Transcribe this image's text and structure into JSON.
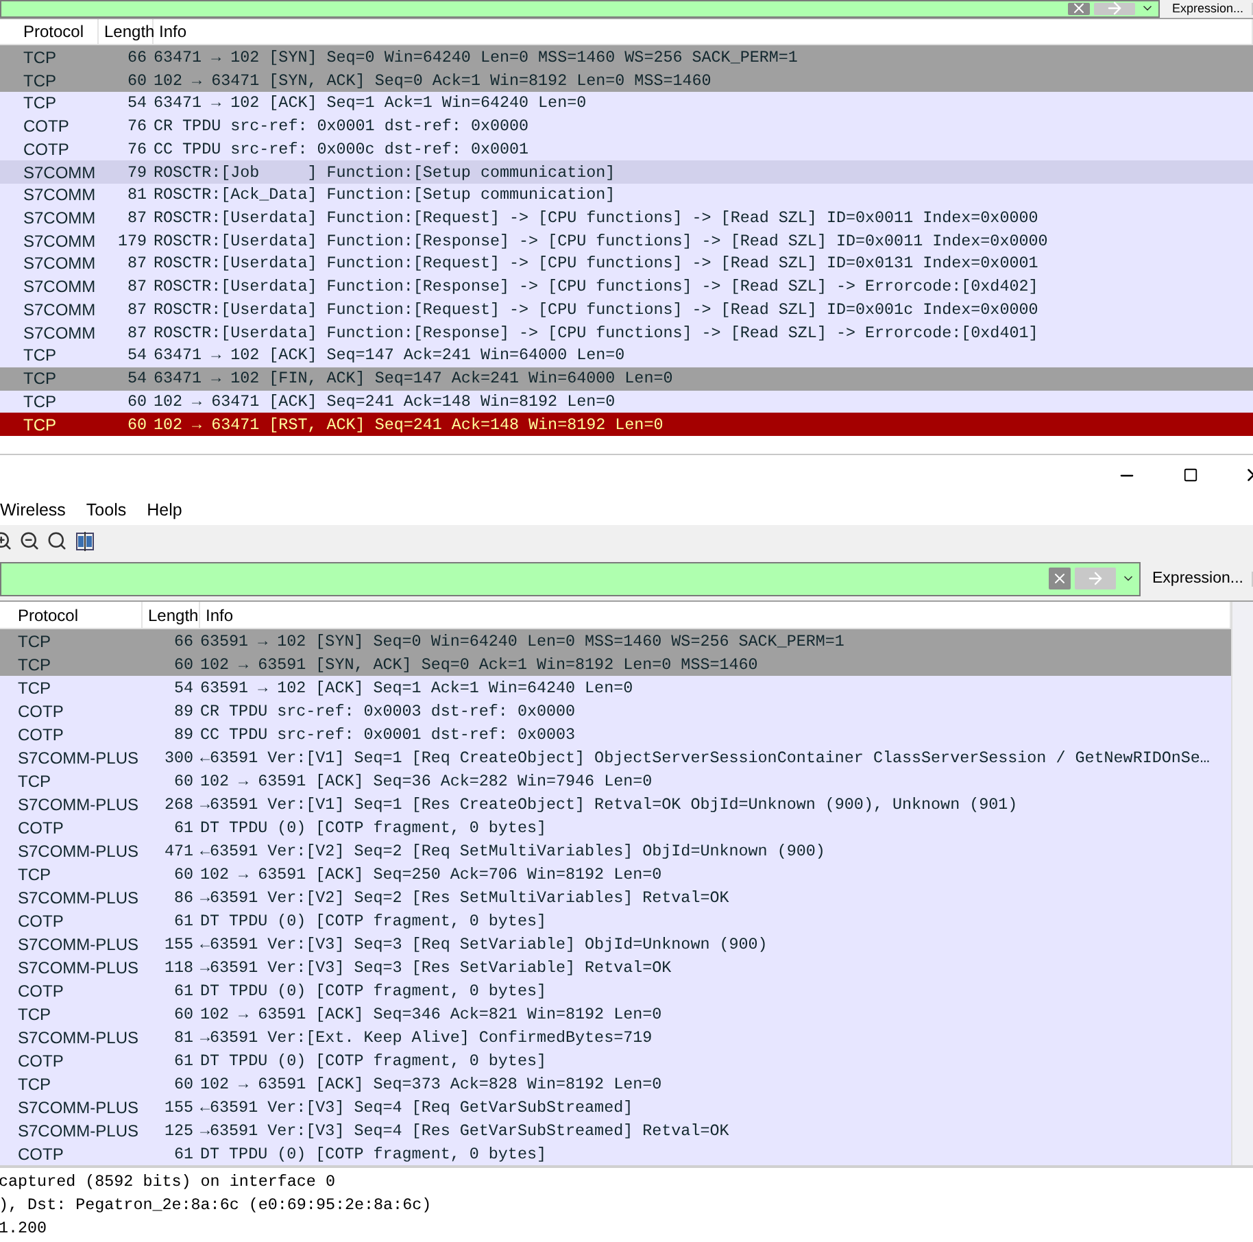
{
  "top_pane": {
    "filter": {
      "expression_button": "Expression..."
    },
    "columns": [
      "Protocol",
      "Length",
      "Info"
    ],
    "rows": [
      {
        "protocol": "TCP",
        "length": "66",
        "info": "63471 → 102 [SYN] Seq=0 Win=64240 Len=0 MSS=1460 WS=256 SACK_PERM=1",
        "kind": "handshake"
      },
      {
        "protocol": "TCP",
        "length": "60",
        "info": "102 → 63471 [SYN, ACK] Seq=0 Ack=1 Win=8192 Len=0 MSS=1460",
        "kind": "handshake"
      },
      {
        "protocol": "TCP",
        "length": "54",
        "info": "63471 → 102 [ACK] Seq=1 Ack=1 Win=64240 Len=0",
        "kind": "normal"
      },
      {
        "protocol": "COTP",
        "length": "76",
        "info": "CR TPDU src-ref: 0x0001 dst-ref: 0x0000",
        "kind": "normal"
      },
      {
        "protocol": "COTP",
        "length": "76",
        "info": "CC TPDU src-ref: 0x000c dst-ref: 0x0001",
        "kind": "normal"
      },
      {
        "protocol": "S7COMM",
        "length": "79",
        "info": "ROSCTR:[Job     ] Function:[Setup communication]",
        "kind": "marked"
      },
      {
        "protocol": "S7COMM",
        "length": "81",
        "info": "ROSCTR:[Ack_Data] Function:[Setup communication]",
        "kind": "normal"
      },
      {
        "protocol": "S7COMM",
        "length": "87",
        "info": "ROSCTR:[Userdata] Function:[Request] -> [CPU functions] -> [Read SZL] ID=0x0011 Index=0x0000",
        "kind": "normal"
      },
      {
        "protocol": "S7COMM",
        "length": "179",
        "info": "ROSCTR:[Userdata] Function:[Response] -> [CPU functions] -> [Read SZL] ID=0x0011 Index=0x0000",
        "kind": "normal"
      },
      {
        "protocol": "S7COMM",
        "length": "87",
        "info": "ROSCTR:[Userdata] Function:[Request] -> [CPU functions] -> [Read SZL] ID=0x0131 Index=0x0001",
        "kind": "normal"
      },
      {
        "protocol": "S7COMM",
        "length": "87",
        "info": "ROSCTR:[Userdata] Function:[Response] -> [CPU functions] -> [Read SZL] -> Errorcode:[0xd402]",
        "kind": "normal"
      },
      {
        "protocol": "S7COMM",
        "length": "87",
        "info": "ROSCTR:[Userdata] Function:[Request] -> [CPU functions] -> [Read SZL] ID=0x001c Index=0x0000",
        "kind": "normal"
      },
      {
        "protocol": "S7COMM",
        "length": "87",
        "info": "ROSCTR:[Userdata] Function:[Response] -> [CPU functions] -> [Read SZL] -> Errorcode:[0xd401]",
        "kind": "normal"
      },
      {
        "protocol": "TCP",
        "length": "54",
        "info": "63471 → 102 [ACK] Seq=147 Ack=241 Win=64000 Len=0",
        "kind": "normal"
      },
      {
        "protocol": "TCP",
        "length": "54",
        "info": "63471 → 102 [FIN, ACK] Seq=147 Ack=241 Win=64000 Len=0",
        "kind": "handshake"
      },
      {
        "protocol": "TCP",
        "length": "60",
        "info": "102 → 63471 [ACK] Seq=241 Ack=148 Win=8192 Len=0",
        "kind": "normal"
      },
      {
        "protocol": "TCP",
        "length": "60",
        "info": "102 → 63471 [RST, ACK] Seq=241 Ack=148 Win=8192 Len=0",
        "kind": "error"
      }
    ]
  },
  "bottom_window": {
    "menu": [
      "Wireless",
      "Tools",
      "Help"
    ],
    "filter": {
      "expression_button": "Expression..."
    },
    "columns": [
      "Protocol",
      "Length",
      "Info"
    ],
    "rows": [
      {
        "protocol": "TCP",
        "length": "66",
        "info": "63591 → 102 [SYN] Seq=0 Win=64240 Len=0 MSS=1460 WS=256 SACK_PERM=1",
        "kind": "handshake"
      },
      {
        "protocol": "TCP",
        "length": "60",
        "info": "102 → 63591 [SYN, ACK] Seq=0 Ack=1 Win=8192 Len=0 MSS=1460",
        "kind": "handshake"
      },
      {
        "protocol": "TCP",
        "length": "54",
        "info": "63591 → 102 [ACK] Seq=1 Ack=1 Win=64240 Len=0",
        "kind": "normal"
      },
      {
        "protocol": "COTP",
        "length": "89",
        "info": "CR TPDU src-ref: 0x0003 dst-ref: 0x0000",
        "kind": "normal"
      },
      {
        "protocol": "COTP",
        "length": "89",
        "info": "CC TPDU src-ref: 0x0001 dst-ref: 0x0003",
        "kind": "normal"
      },
      {
        "protocol": "S7COMM-PLUS",
        "length": "300",
        "info": "←63591 Ver:[V1] Seq=1 [Req CreateObject] ObjectServerSessionContainer ClassServerSession / GetNewRIDOnSe…",
        "kind": "normal"
      },
      {
        "protocol": "TCP",
        "length": "60",
        "info": "102 → 63591 [ACK] Seq=36 Ack=282 Win=7946 Len=0",
        "kind": "normal"
      },
      {
        "protocol": "S7COMM-PLUS",
        "length": "268",
        "info": "→63591 Ver:[V1] Seq=1 [Res CreateObject] Retval=OK ObjId=Unknown (900), Unknown (901)",
        "kind": "normal"
      },
      {
        "protocol": "COTP",
        "length": "61",
        "info": "DT TPDU (0) [COTP fragment, 0 bytes]",
        "kind": "normal"
      },
      {
        "protocol": "S7COMM-PLUS",
        "length": "471",
        "info": "←63591 Ver:[V2] Seq=2 [Req SetMultiVariables] ObjId=Unknown (900)",
        "kind": "normal"
      },
      {
        "protocol": "TCP",
        "length": "60",
        "info": "102 → 63591 [ACK] Seq=250 Ack=706 Win=8192 Len=0",
        "kind": "normal"
      },
      {
        "protocol": "S7COMM-PLUS",
        "length": "86",
        "info": "→63591 Ver:[V2] Seq=2 [Res SetMultiVariables] Retval=OK",
        "kind": "normal"
      },
      {
        "protocol": "COTP",
        "length": "61",
        "info": "DT TPDU (0) [COTP fragment, 0 bytes]",
        "kind": "normal"
      },
      {
        "protocol": "S7COMM-PLUS",
        "length": "155",
        "info": "←63591 Ver:[V3] Seq=3 [Req SetVariable] ObjId=Unknown (900)",
        "kind": "normal"
      },
      {
        "protocol": "S7COMM-PLUS",
        "length": "118",
        "info": "→63591 Ver:[V3] Seq=3 [Res SetVariable] Retval=OK",
        "kind": "normal"
      },
      {
        "protocol": "COTP",
        "length": "61",
        "info": "DT TPDU (0) [COTP fragment, 0 bytes]",
        "kind": "normal"
      },
      {
        "protocol": "TCP",
        "length": "60",
        "info": "102 → 63591 [ACK] Seq=346 Ack=821 Win=8192 Len=0",
        "kind": "normal"
      },
      {
        "protocol": "S7COMM-PLUS",
        "length": "81",
        "info": "→63591 Ver:[Ext. Keep Alive] ConfirmedBytes=719",
        "kind": "normal"
      },
      {
        "protocol": "COTP",
        "length": "61",
        "info": "DT TPDU (0) [COTP fragment, 0 bytes]",
        "kind": "normal"
      },
      {
        "protocol": "TCP",
        "length": "60",
        "info": "102 → 63591 [ACK] Seq=373 Ack=828 Win=8192 Len=0",
        "kind": "normal"
      },
      {
        "protocol": "S7COMM-PLUS",
        "length": "155",
        "info": "←63591 Ver:[V3] Seq=4 [Req GetVarSubStreamed]",
        "kind": "normal"
      },
      {
        "protocol": "S7COMM-PLUS",
        "length": "125",
        "info": "→63591 Ver:[V3] Seq=4 [Res GetVarSubStreamed] Retval=OK",
        "kind": "normal"
      },
      {
        "protocol": "COTP",
        "length": "61",
        "info": "DT TPDU (0) [COTP fragment, 0 bytes]",
        "kind": "normal"
      }
    ],
    "details": [
      "captured (8592 bits) on interface 0",
      "), Dst: Pegatron_2e:8a:6c (e0:69:95:2e:8a:6c)",
      "1.200"
    ]
  }
}
